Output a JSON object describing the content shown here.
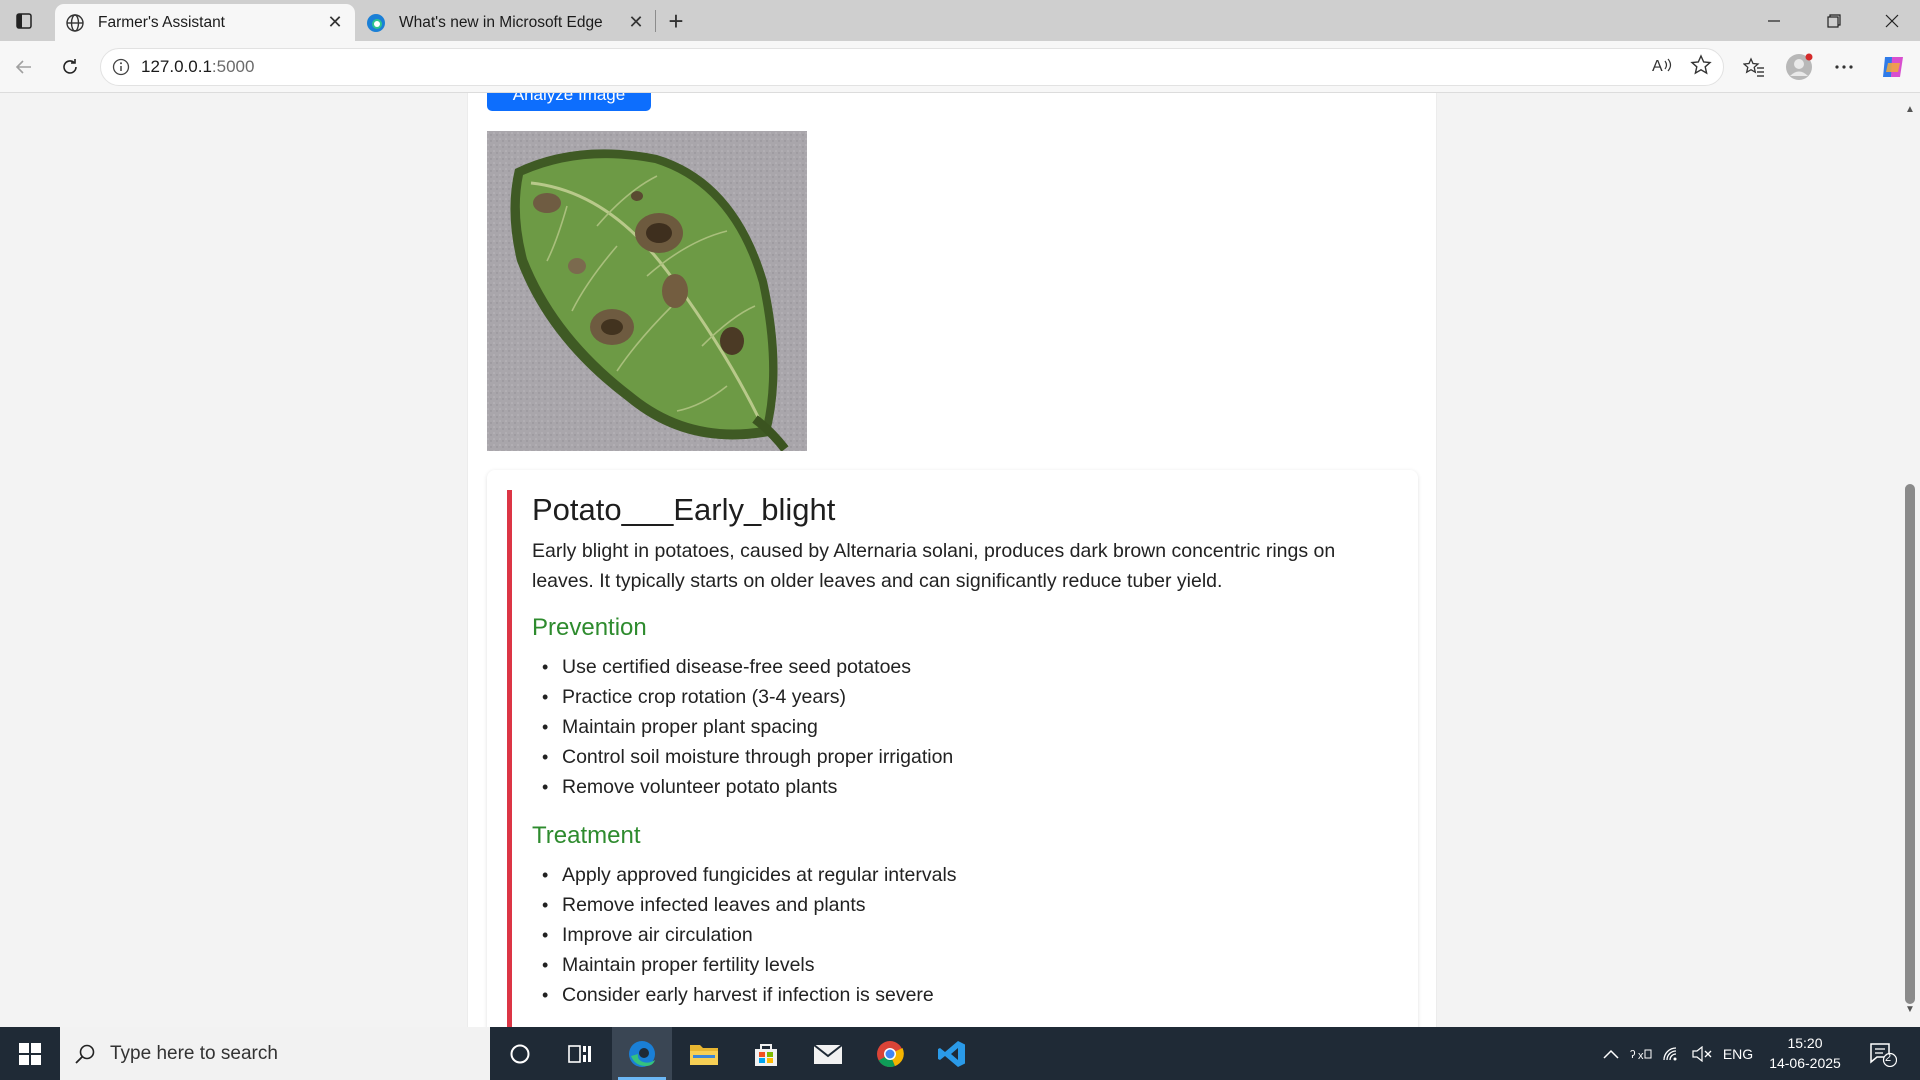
{
  "browser": {
    "tabs": [
      {
        "title": "Farmer's Assistant",
        "active": true
      },
      {
        "title": "What's new in Microsoft Edge",
        "active": false
      }
    ],
    "url_host": "127.0.0.1",
    "url_port": ":5000"
  },
  "page": {
    "analyze_button_label": "Analyze Image",
    "result": {
      "disease_name": "Potato___Early_blight",
      "description": "Early blight in potatoes, caused by Alternaria solani, produces dark brown concentric rings on leaves. It typically starts on older leaves and can significantly reduce tuber yield.",
      "prevention_heading": "Prevention",
      "prevention": [
        "Use certified disease-free seed potatoes",
        "Practice crop rotation (3-4 years)",
        "Maintain proper plant spacing",
        "Control soil moisture through proper irrigation",
        "Remove volunteer potato plants"
      ],
      "treatment_heading": "Treatment",
      "treatment": [
        "Apply approved fungicides at regular intervals",
        "Remove infected leaves and plants",
        "Improve air circulation",
        "Maintain proper fertility levels",
        "Consider early harvest if infection is severe"
      ]
    }
  },
  "taskbar": {
    "search_placeholder": "Type here to search",
    "language": "ENG",
    "time": "15:20",
    "date": "14-06-2025",
    "notification_count": "2"
  },
  "colors": {
    "accent_blue": "#0d6efd",
    "danger_red": "#dc3545",
    "heading_green": "#2e8b2e"
  }
}
